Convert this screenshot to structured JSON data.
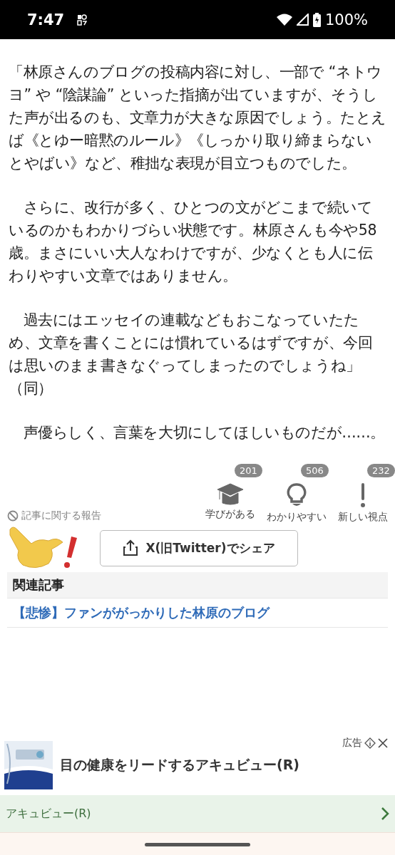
{
  "status_bar": {
    "time": "7:47",
    "battery": "100%"
  },
  "article": {
    "paragraphs": [
      "「林原さんのブログの投稿内容に対し、一部で “ネトウヨ” や “陰謀論” といった指摘が出ていますが、そうした声が出るのも、文章力が大きな原因でしょう。たとえば《とゆー暗黙のルール》《しっかり取り締まらないとやばい》など、稚拙な表現が目立つものでした。",
      "　さらに、改行が多く、ひとつの文がどこまで続いているのかもわかりづらい状態です。林原さんも今や58歳。まさにいい大人なわけですが、少なくとも人に伝わりやすい文章ではありません。",
      "　過去にはエッセイの連載などもおこなっていたため、文章を書くことには慣れているはずですが、今回は思いのまま書きなぐってしまったのでしょうね」（同）",
      "　声優らしく、言葉を大切にしてほしいものだが……。"
    ]
  },
  "report_link": "記事に関する報告",
  "reactions": [
    {
      "kind": "cap",
      "label": "学びがある",
      "count": "201"
    },
    {
      "kind": "bulb",
      "label": "わかりやすい",
      "count": "506"
    },
    {
      "kind": "exclaim",
      "label": "新しい視点",
      "count": "232"
    }
  ],
  "share_button": "X(旧Twitter)でシェア",
  "related": {
    "heading": "関連記事",
    "links": [
      "【悲惨】ファンががっかりした林原のブログ"
    ]
  },
  "ad": {
    "label": "広告",
    "title": "目の健康をリードするアキュビュー(R)",
    "advertiser": "アキュビュー(R)"
  }
}
